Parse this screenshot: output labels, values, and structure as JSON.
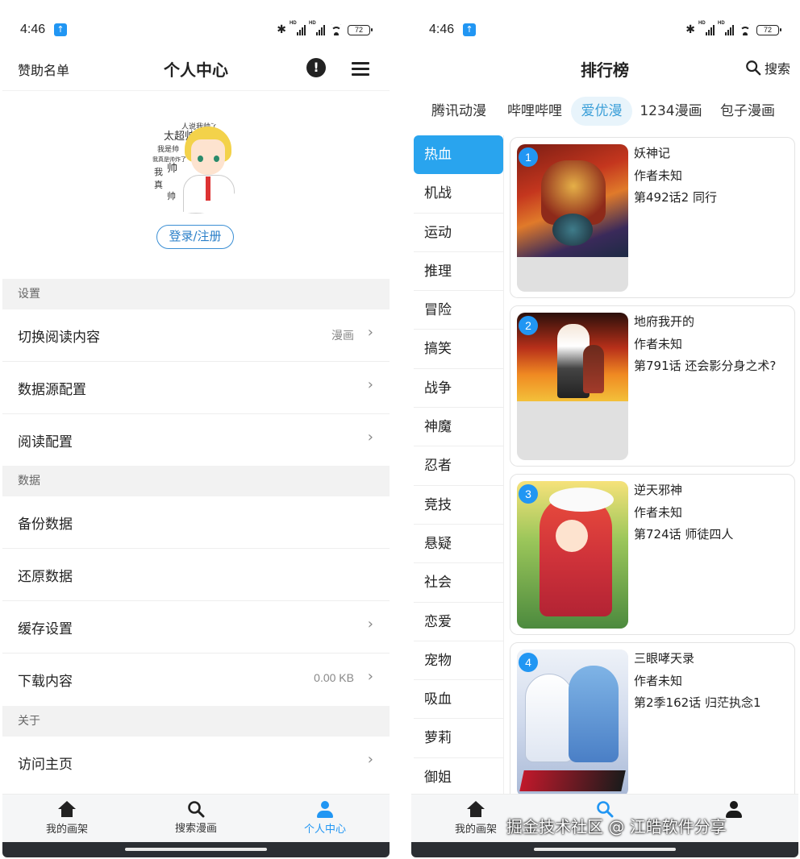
{
  "left": {
    "status": {
      "time": "4:46",
      "battery": "72"
    },
    "appbar": {
      "left_text": "赞助名单",
      "title": "个人中心"
    },
    "profile": {
      "avatar_words": [
        "人说我帅了",
        "太超帅",
        "我是帅",
        "我真是帅炸了",
        "帅",
        "我",
        "真",
        "帅"
      ],
      "login_label": "登录/注册"
    },
    "sections": {
      "settings": "设置",
      "data": "数据",
      "about": "关于"
    },
    "rows": {
      "switch_content": {
        "label": "切换阅读内容",
        "value": "漫画"
      },
      "datasource": {
        "label": "数据源配置"
      },
      "reading": {
        "label": "阅读配置"
      },
      "backup": {
        "label": "备份数据"
      },
      "restore": {
        "label": "还原数据"
      },
      "cache": {
        "label": "缓存设置"
      },
      "download": {
        "label": "下载内容",
        "value": "0.00 KB"
      },
      "homepage": {
        "label": "访问主页"
      }
    },
    "nav": {
      "shelf": "我的画架",
      "search": "搜索漫画",
      "profile": "个人中心"
    }
  },
  "right": {
    "status": {
      "time": "4:46",
      "battery": "72"
    },
    "header": {
      "title": "排行榜",
      "search": "搜索"
    },
    "sources": [
      "腾讯动漫",
      "哔哩哔哩",
      "爱优漫",
      "1234漫画",
      "包子漫画"
    ],
    "active_source": "爱优漫",
    "categories": [
      "热血",
      "机战",
      "运动",
      "推理",
      "冒险",
      "搞笑",
      "战争",
      "神魔",
      "忍者",
      "竞技",
      "悬疑",
      "社会",
      "恋爱",
      "宠物",
      "吸血",
      "萝莉",
      "御姐"
    ],
    "active_category": "热血",
    "comics": [
      {
        "rank": "1",
        "title": "妖神记",
        "author": "作者未知",
        "chapter": "第492话2 同行"
      },
      {
        "rank": "2",
        "title": "地府我开的",
        "author": "作者未知",
        "chapter": "第791话 还会影分身之术?"
      },
      {
        "rank": "3",
        "title": "逆天邪神",
        "author": "作者未知",
        "chapter": "第724话 师徒四人"
      },
      {
        "rank": "4",
        "title": "三眼哮天录",
        "author": "作者未知",
        "chapter": "第2季162话 归茫执念1"
      }
    ],
    "nav": {
      "shelf": "我的画架"
    }
  },
  "watermark": "掘金技术社区 @ 江皓软件分享",
  "colors": {
    "accent": "#2196f3",
    "active_category": "#29a4ee"
  }
}
